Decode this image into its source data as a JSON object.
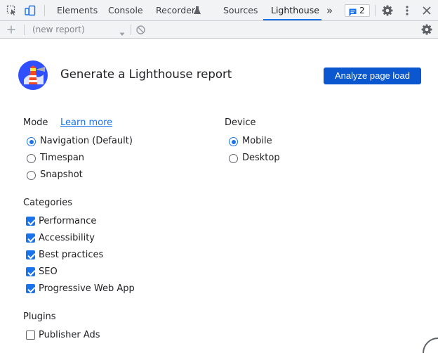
{
  "devtools": {
    "tabs": [
      {
        "label": "Elements",
        "active": false
      },
      {
        "label": "Console",
        "active": false
      },
      {
        "label": "Recorder",
        "active": false
      },
      {
        "label": "Sources",
        "active": false
      },
      {
        "label": "Lighthouse",
        "active": true
      }
    ],
    "more_tabs_glyph": "»",
    "issues_count": "2",
    "icons": [
      "inspect-element-icon",
      "device-toolbar-icon",
      "recorder-flask-icon",
      "more-tabs-icon",
      "issues-icon",
      "settings-gear-icon",
      "more-vertical-icon",
      "close-icon"
    ]
  },
  "toolbar": {
    "report_placeholder": "(new report)",
    "icons": [
      "add-icon",
      "dropdown-arrow-icon",
      "clear-icon",
      "lighthouse-settings-icon"
    ]
  },
  "main": {
    "title": "Generate a Lighthouse report",
    "analyze_button": "Analyze page load",
    "mode": {
      "title": "Mode",
      "learn_more": "Learn more",
      "options": [
        {
          "label": "Navigation (Default)",
          "checked": true
        },
        {
          "label": "Timespan",
          "checked": false
        },
        {
          "label": "Snapshot",
          "checked": false
        }
      ]
    },
    "device": {
      "title": "Device",
      "options": [
        {
          "label": "Mobile",
          "checked": true
        },
        {
          "label": "Desktop",
          "checked": false
        }
      ]
    },
    "categories": {
      "title": "Categories",
      "items": [
        {
          "label": "Performance",
          "checked": true
        },
        {
          "label": "Accessibility",
          "checked": true
        },
        {
          "label": "Best practices",
          "checked": true
        },
        {
          "label": "SEO",
          "checked": true
        },
        {
          "label": "Progressive Web App",
          "checked": true
        }
      ]
    },
    "plugins": {
      "title": "Plugins",
      "items": [
        {
          "label": "Publisher Ads",
          "checked": false
        }
      ]
    }
  },
  "colors": {
    "accent": "#1a73e8",
    "primary_button": "#0b57d0",
    "chrome_bg": "#f1f3f4"
  }
}
